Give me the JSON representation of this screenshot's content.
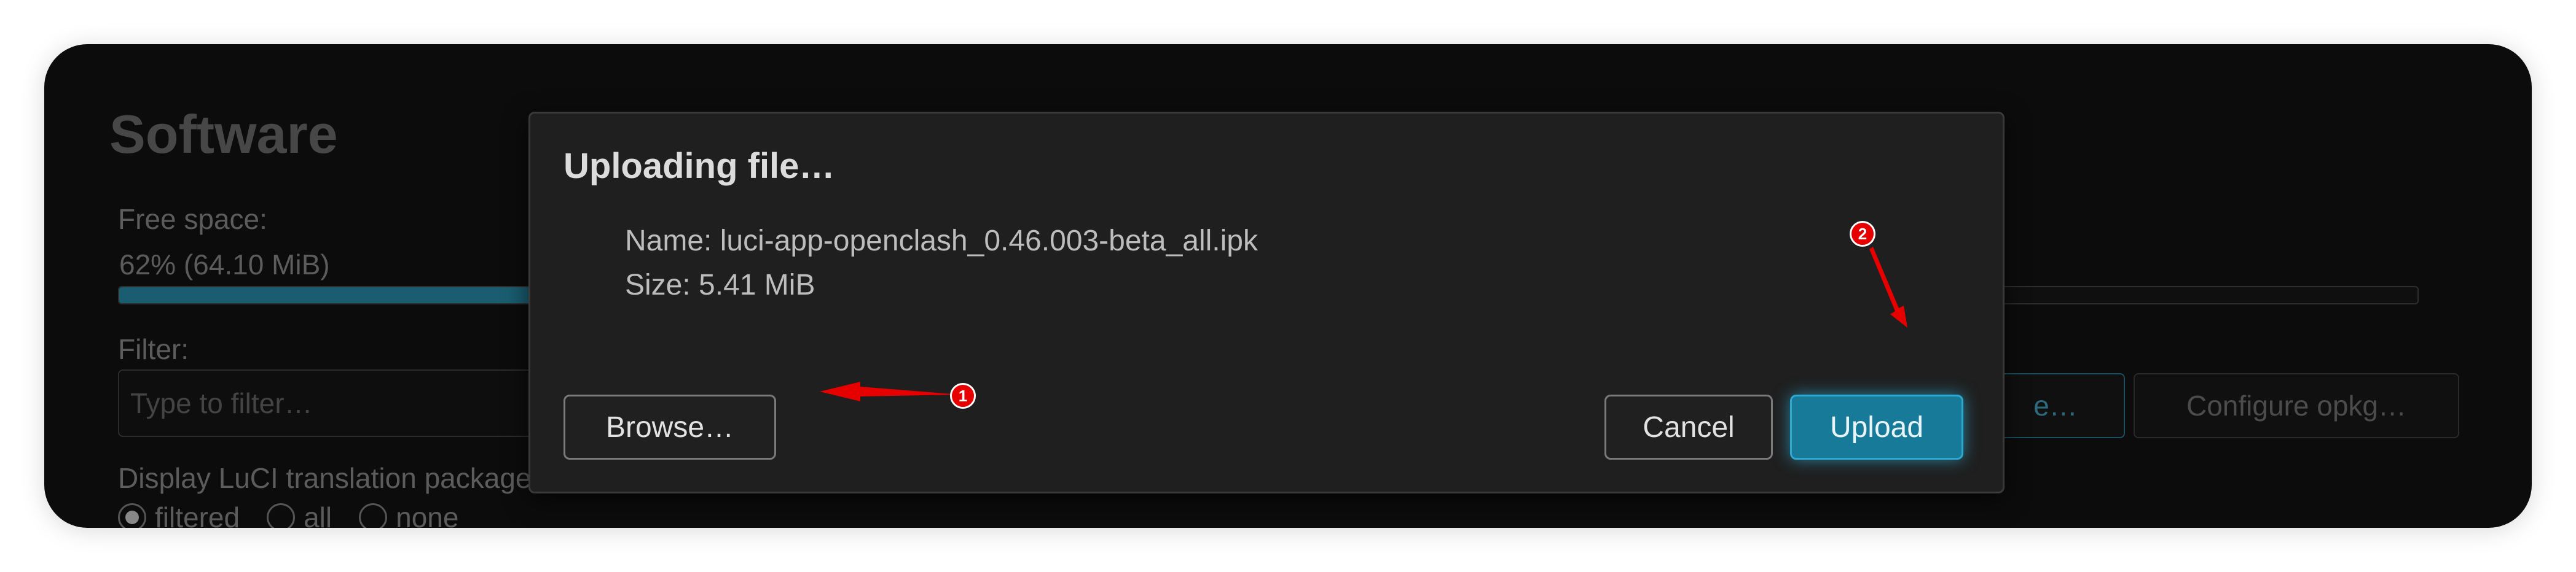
{
  "page": {
    "title": "Software",
    "free_space_label": "Free space:",
    "free_space_value": "62% (64.10 MiB)",
    "free_space_fraction": 0.62,
    "filter_label": "Filter:",
    "filter_placeholder": "Type to filter…",
    "upload_package_button_partial": "e…",
    "configure_button": "Configure opkg…",
    "translation_label": "Display LuCI translation packages:",
    "translation_options": [
      "filtered",
      "all",
      "none"
    ],
    "translation_selected": "filtered"
  },
  "modal": {
    "title": "Uploading file…",
    "name_line": "Name: luci-app-openclash_0.46.003-beta_all.ipk",
    "size_line": "Size: 5.41 MiB",
    "browse_label": "Browse…",
    "cancel_label": "Cancel",
    "upload_label": "Upload"
  },
  "annotations": {
    "badge_1": "1",
    "badge_2": "2",
    "arrow_color": "#e60000"
  },
  "colors": {
    "accent": "#177a99",
    "accent_border": "#2ea9d2",
    "modal_bg": "#1f1f1f",
    "page_bg": "#0c0c0c"
  }
}
